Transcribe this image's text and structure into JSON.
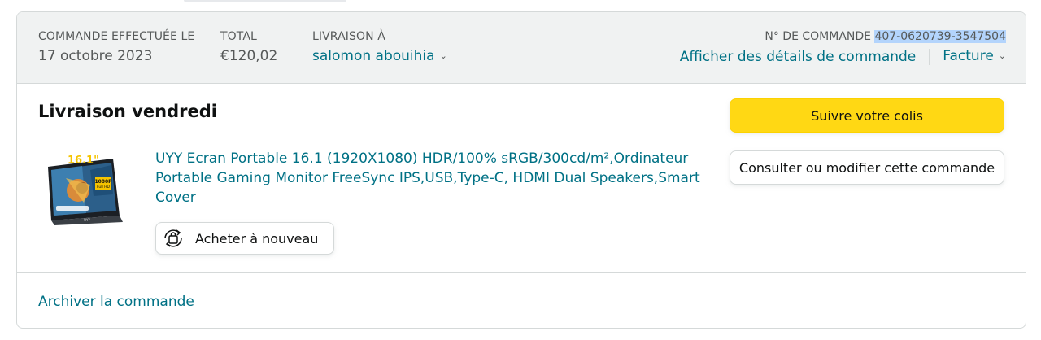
{
  "colors": {
    "link": "#007185",
    "header_bg": "#f0f2f2",
    "border": "#d5d9d9",
    "primary_button": "#ffd814",
    "text": "#0f1111",
    "muted": "#565959",
    "selection": "#b3d4fc"
  },
  "header": {
    "order_placed_label": "COMMANDE EFFECTUÉE LE",
    "order_placed_value": "17 octobre 2023",
    "total_label": "TOTAL",
    "total_value": "€120,02",
    "ship_to_label": "LIVRAISON À",
    "ship_to_value": "salomon abouihia",
    "order_number_label": "N° DE COMMANDE",
    "order_number_value": "407-0620739-3547504",
    "details_link": "Afficher des détails de commande",
    "invoice_link": "Facture"
  },
  "shipment": {
    "title": "Livraison vendredi",
    "product": {
      "title": "UYY Ecran Portable 16.1 (1920X1080) HDR/100% sRGB/300cd/m²,Ordinateur Portable Gaming Monitor FreeSync IPS,USB,Type-C, HDMI Dual Speakers,Smart Cover",
      "image_icon": "portable-monitor-image",
      "image_badge_size": "16.1\"",
      "image_badge_res": "1080P",
      "image_badge_hd": "Full HD",
      "image_brand": "UYY"
    },
    "buy_again_label": "Acheter à nouveau",
    "buy_again_icon": "buy-again-icon",
    "track_button": "Suivre votre colis",
    "view_button": "Consulter ou modifier cette commande"
  },
  "footer": {
    "archive_link": "Archiver la commande"
  }
}
